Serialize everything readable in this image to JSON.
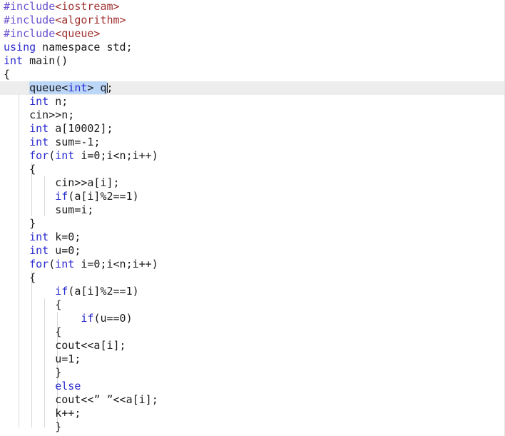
{
  "editor": {
    "language": "C++",
    "font_size_px": 15,
    "line_height_px": 19,
    "background": "#ffffff",
    "current_line_background": "#ededed",
    "selection_background": "#bcd6f7",
    "keyword_color": "#2b2bd0",
    "preprocessor_color": "#6a4fcf",
    "header_name_color": "#a03030",
    "text_color": "#1a1a1a",
    "indent_guide_color": "#d8d8dd",
    "current_line_index": 7,
    "selection_text": "queue<int> q"
  },
  "lines": [
    {
      "n": 1,
      "indent": 0,
      "text": "#include<iostream>"
    },
    {
      "n": 2,
      "indent": 0,
      "text": "#include<algorithm>"
    },
    {
      "n": 3,
      "indent": 0,
      "text": "#include<queue>"
    },
    {
      "n": 4,
      "indent": 0,
      "text": "using namespace std;"
    },
    {
      "n": 5,
      "indent": 0,
      "text": "int main()"
    },
    {
      "n": 6,
      "indent": 0,
      "text": "{"
    },
    {
      "n": 7,
      "indent": 1,
      "text": "queue<int> q;"
    },
    {
      "n": 8,
      "indent": 1,
      "text": "int n;"
    },
    {
      "n": 9,
      "indent": 1,
      "text": "cin>>n;"
    },
    {
      "n": 10,
      "indent": 1,
      "text": "int a[10002];"
    },
    {
      "n": 11,
      "indent": 1,
      "text": "int sum=-1;"
    },
    {
      "n": 12,
      "indent": 1,
      "text": "for(int i=0;i<n;i++)"
    },
    {
      "n": 13,
      "indent": 1,
      "text": "{"
    },
    {
      "n": 14,
      "indent": 2,
      "text": "cin>>a[i];"
    },
    {
      "n": 15,
      "indent": 2,
      "text": "if(a[i]%2==1)"
    },
    {
      "n": 16,
      "indent": 2,
      "text": "sum=i;"
    },
    {
      "n": 17,
      "indent": 1,
      "text": "}"
    },
    {
      "n": 18,
      "indent": 1,
      "text": "int k=0;"
    },
    {
      "n": 19,
      "indent": 1,
      "text": "int u=0;"
    },
    {
      "n": 20,
      "indent": 1,
      "text": "for(int i=0;i<n;i++)"
    },
    {
      "n": 21,
      "indent": 1,
      "text": "{"
    },
    {
      "n": 22,
      "indent": 2,
      "text": "if(a[i]%2==1)"
    },
    {
      "n": 23,
      "indent": 2,
      "text": "{"
    },
    {
      "n": 24,
      "indent": 3,
      "text": "if(u==0)"
    },
    {
      "n": 25,
      "indent": 2,
      "text": "{"
    },
    {
      "n": 26,
      "indent": 2,
      "text": "cout<<a[i];"
    },
    {
      "n": 27,
      "indent": 2,
      "text": "u=1;"
    },
    {
      "n": 28,
      "indent": 2,
      "text": "}"
    },
    {
      "n": 29,
      "indent": 2,
      "text": "else"
    },
    {
      "n": 30,
      "indent": 2,
      "text": "cout<<” ”<<a[i];"
    },
    {
      "n": 31,
      "indent": 2,
      "text": "k++;"
    },
    {
      "n": 32,
      "indent": 2,
      "text": "}"
    }
  ]
}
